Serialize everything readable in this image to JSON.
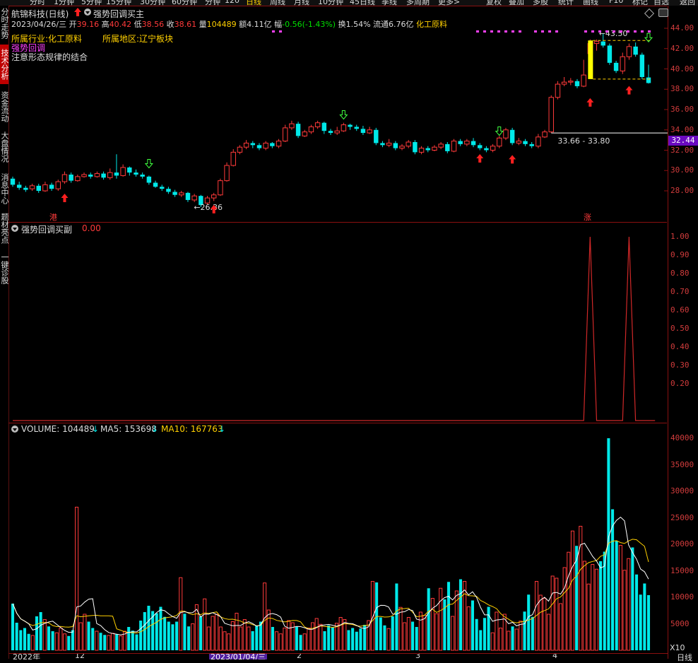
{
  "toolbar": {
    "items": [
      "分时",
      "1分钟",
      "5分钟",
      "15分钟",
      "30分钟",
      "60分钟",
      "分钟",
      "120",
      "日线",
      "周线",
      "月线",
      "10分钟",
      "45日线",
      "季线",
      "多周期",
      "更多>",
      "复权",
      "叠加",
      "多股",
      "统计",
      "画线",
      "F10",
      "标记",
      "自选",
      "返回"
    ],
    "active": "日线"
  },
  "sidebar": {
    "tabs": [
      "分时走势",
      "技术分析",
      "资金流动",
      "大盘情况",
      "消息中心",
      "题材亮点",
      "一键诊股"
    ],
    "active": "技术分析"
  },
  "header": {
    "stock": "航锦科技(日线)",
    "indicator": "强势回调买主",
    "date": "2023/04/26/三",
    "open_label": "开",
    "open": "39.16",
    "high_label": "高",
    "high": "40.42",
    "low_label": "低",
    "low": "38.56",
    "close_label": "收",
    "close": "38.61",
    "vol_label": "量",
    "vol": "104489",
    "amount_label": "额",
    "amount": "4.11亿",
    "change_label": "幅",
    "change": "-0.56(-1.43%)",
    "turnover_label": "换",
    "turnover": "1.54%",
    "float_label": "流通",
    "float": "6.76亿",
    "sector": "化工原料"
  },
  "info": {
    "industry": "所属行业:化工原料",
    "region": "所属地区:辽宁板块",
    "signal": "强势回调",
    "note": "注意形态规律的结合"
  },
  "price_annotations": {
    "high_mark": "43.50",
    "low_mark": "26.36",
    "range": "33.66 - 33.80",
    "current_price": "32.44",
    "label_gang": "港",
    "label_zhang": "涨"
  },
  "price_axis": [
    "44.00",
    "42.00",
    "40.00",
    "38.00",
    "36.00",
    "34.00",
    "32.00",
    "30.00",
    "28.00"
  ],
  "sub_panel": {
    "title": "强势回调买副",
    "value": "0.00",
    "axis": [
      "1.00",
      "0.90",
      "0.80",
      "0.70",
      "0.60",
      "0.50",
      "0.40",
      "0.30",
      "0.20"
    ]
  },
  "volume_panel": {
    "vol_label": "VOLUME: 104489",
    "ma5_label": "MA5: 153698",
    "ma10_label": "MA10: 167763",
    "axis": [
      "40000",
      "35000",
      "30000",
      "25000",
      "20000",
      "15000",
      "10000",
      "5000"
    ],
    "unit": "X10"
  },
  "bottom_axis": {
    "labels": [
      "2022年",
      "12",
      "2023/01/04/三",
      "2",
      "3",
      "4"
    ],
    "period": "日线"
  },
  "colors": {
    "up": "#ff3a3a",
    "down": "#00e8e8",
    "ma5": "#ffffff",
    "ma10": "#ffd000",
    "grid": "#8a1010",
    "signal": "#ff40ff"
  },
  "chart_data": {
    "type": "candlestick",
    "title": "航锦科技(日线)",
    "ylim": [
      25.5,
      44.5
    ],
    "candles": [
      [
        29.2,
        28.6,
        29.4,
        28.4
      ],
      [
        28.6,
        28.3,
        28.9,
        28.1
      ],
      [
        28.3,
        28.1,
        28.5,
        27.9
      ],
      [
        28.2,
        28.5,
        28.7,
        28.0
      ],
      [
        28.5,
        28.0,
        28.7,
        27.8
      ],
      [
        28.0,
        28.6,
        28.9,
        27.9
      ],
      [
        28.6,
        28.2,
        28.8,
        28.0
      ],
      [
        28.2,
        28.9,
        29.1,
        28.0
      ],
      [
        28.9,
        29.6,
        29.9,
        28.7
      ],
      [
        29.6,
        29.0,
        29.8,
        28.8
      ],
      [
        29.0,
        29.4,
        29.6,
        28.9
      ],
      [
        29.4,
        29.6,
        29.8,
        29.3
      ],
      [
        29.6,
        29.4,
        29.8,
        29.2
      ],
      [
        29.4,
        29.7,
        29.9,
        29.3
      ],
      [
        29.7,
        29.3,
        29.9,
        29.1
      ],
      [
        29.3,
        29.8,
        30.2,
        29.1
      ],
      [
        29.8,
        29.5,
        31.6,
        29.2
      ],
      [
        29.5,
        30.3,
        30.6,
        29.4
      ],
      [
        30.3,
        29.8,
        30.4,
        29.5
      ],
      [
        29.8,
        29.6,
        30.1,
        29.4
      ],
      [
        29.6,
        29.4,
        29.8,
        29.2
      ],
      [
        29.4,
        28.8,
        29.5,
        28.6
      ],
      [
        28.8,
        28.4,
        29.0,
        28.3
      ],
      [
        28.4,
        28.2,
        28.6,
        28.0
      ],
      [
        28.2,
        27.9,
        28.4,
        27.7
      ],
      [
        27.9,
        27.6,
        28.1,
        27.4
      ],
      [
        27.6,
        27.8,
        28.0,
        27.4
      ],
      [
        27.8,
        27.1,
        27.9,
        26.9
      ],
      [
        27.1,
        27.5,
        27.7,
        26.9
      ],
      [
        27.5,
        26.6,
        27.6,
        26.4
      ],
      [
        26.8,
        27.3,
        27.5,
        26.6
      ],
      [
        27.3,
        27.6,
        27.8,
        27.0
      ],
      [
        27.6,
        29.0,
        29.2,
        27.5
      ],
      [
        29.0,
        30.5,
        30.8,
        28.9
      ],
      [
        30.5,
        31.8,
        32.1,
        30.4
      ],
      [
        31.8,
        32.3,
        32.5,
        31.6
      ],
      [
        32.3,
        32.7,
        33.0,
        32.1
      ],
      [
        32.7,
        32.5,
        32.9,
        32.2
      ],
      [
        32.5,
        32.2,
        32.7,
        32.0
      ],
      [
        32.2,
        32.7,
        32.9,
        32.0
      ],
      [
        32.7,
        32.4,
        32.8,
        32.2
      ],
      [
        32.4,
        32.9,
        33.1,
        32.2
      ],
      [
        32.9,
        34.2,
        34.5,
        32.8
      ],
      [
        34.2,
        34.6,
        34.9,
        34.0
      ],
      [
        34.6,
        33.4,
        34.8,
        33.2
      ],
      [
        33.4,
        33.8,
        34.0,
        33.3
      ],
      [
        33.8,
        34.3,
        34.5,
        33.6
      ],
      [
        34.3,
        34.7,
        34.9,
        34.1
      ],
      [
        34.7,
        33.9,
        34.8,
        33.6
      ],
      [
        33.9,
        33.7,
        34.1,
        33.5
      ],
      [
        33.7,
        33.9,
        34.3,
        33.5
      ],
      [
        33.9,
        34.5,
        34.7,
        33.8
      ],
      [
        34.5,
        34.3,
        34.6,
        34.0
      ],
      [
        34.3,
        34.1,
        34.5,
        33.9
      ],
      [
        34.1,
        33.7,
        34.4,
        33.5
      ],
      [
        33.7,
        34.0,
        34.3,
        33.6
      ],
      [
        34.0,
        32.7,
        34.2,
        32.5
      ],
      [
        32.7,
        32.5,
        32.9,
        32.3
      ],
      [
        32.5,
        32.7,
        33.1,
        32.3
      ],
      [
        32.7,
        32.2,
        32.9,
        32.0
      ],
      [
        32.2,
        32.4,
        32.6,
        32.0
      ],
      [
        32.4,
        32.8,
        33.0,
        32.2
      ],
      [
        32.8,
        31.8,
        33.0,
        31.6
      ],
      [
        31.8,
        32.2,
        32.4,
        31.6
      ],
      [
        32.2,
        32.0,
        32.4,
        31.8
      ],
      [
        32.0,
        32.3,
        32.5,
        31.9
      ],
      [
        32.3,
        32.6,
        32.8,
        32.1
      ],
      [
        32.6,
        31.9,
        32.8,
        31.7
      ],
      [
        31.9,
        32.9,
        33.1,
        31.8
      ],
      [
        32.9,
        32.6,
        33.1,
        32.4
      ],
      [
        32.6,
        32.9,
        33.1,
        32.4
      ],
      [
        32.9,
        32.5,
        33.2,
        32.3
      ],
      [
        32.5,
        32.2,
        32.7,
        32.0
      ],
      [
        32.2,
        32.0,
        32.4,
        31.8
      ],
      [
        32.0,
        32.4,
        32.6,
        31.8
      ],
      [
        32.4,
        33.2,
        33.4,
        32.2
      ],
      [
        33.2,
        34.0,
        34.2,
        33.0
      ],
      [
        34.0,
        32.7,
        34.2,
        32.5
      ],
      [
        32.7,
        32.9,
        33.2,
        32.5
      ],
      [
        32.9,
        32.6,
        33.1,
        32.4
      ],
      [
        32.6,
        32.4,
        32.8,
        32.2
      ],
      [
        32.4,
        33.3,
        33.6,
        32.2
      ],
      [
        33.3,
        33.8,
        34.0,
        33.2
      ],
      [
        33.8,
        37.2,
        37.4,
        33.7
      ],
      [
        37.2,
        38.5,
        38.8,
        37.0
      ],
      [
        38.5,
        38.7,
        39.2,
        38.3
      ],
      [
        38.7,
        38.8,
        39.1,
        38.4
      ],
      [
        38.8,
        38.3,
        39.0,
        38.1
      ],
      [
        38.3,
        39.4,
        40.9,
        38.2
      ],
      [
        41.5,
        42.5,
        42.9,
        41.3
      ],
      [
        42.5,
        42.7,
        42.9,
        41.8
      ],
      [
        42.7,
        42.3,
        43.5,
        42.1
      ],
      [
        42.3,
        40.6,
        42.5,
        40.4
      ],
      [
        40.6,
        39.8,
        40.8,
        39.6
      ],
      [
        39.8,
        41.2,
        41.6,
        39.5
      ],
      [
        41.2,
        42.2,
        42.5,
        40.9
      ],
      [
        42.2,
        41.4,
        42.6,
        41.2
      ],
      [
        41.4,
        39.2,
        41.6,
        39.0
      ],
      [
        39.16,
        38.61,
        40.42,
        38.56
      ]
    ],
    "signal_values": [
      0,
      0,
      0,
      0,
      0,
      0,
      0,
      0,
      0,
      0,
      0,
      0,
      0,
      0,
      0,
      0,
      0,
      0,
      0,
      0,
      0,
      0,
      0,
      0,
      0,
      0,
      0,
      0,
      0,
      0,
      0,
      0,
      0,
      0,
      0,
      0,
      0,
      0,
      0,
      0,
      0,
      0,
      0,
      0,
      0,
      0,
      0,
      0,
      0,
      0,
      0,
      0,
      0,
      0,
      0,
      0,
      0,
      0,
      0,
      0,
      0,
      0,
      0,
      0,
      0,
      0,
      0,
      0,
      0,
      0,
      0,
      0,
      0,
      0,
      0,
      0,
      0,
      0,
      0,
      0,
      0,
      0,
      0,
      0,
      0,
      0,
      0,
      0,
      0,
      1,
      0,
      0,
      0,
      0,
      0,
      1,
      0,
      0,
      0,
      0
    ],
    "volume": [
      8800,
      5200,
      3800,
      4200,
      3100,
      2800,
      6400,
      7200,
      5800,
      4500,
      3600,
      3300,
      4200,
      3100,
      2700,
      3800,
      27000,
      5200,
      6800,
      5400,
      4200,
      3600,
      3300,
      2900,
      2800,
      3200,
      3000,
      2700,
      3600,
      4400,
      3700,
      3000,
      5600,
      7200,
      8400,
      7400,
      7000,
      8200,
      6300,
      5400,
      4900,
      5400,
      13700,
      6900,
      4500,
      5000,
      8600,
      6400,
      9700,
      4400,
      6400,
      6800,
      4400,
      3500,
      3100,
      5400,
      7000,
      4400,
      5800,
      4400,
      3600,
      4600,
      5400,
      12700,
      7600,
      4400,
      3500,
      3100,
      4200,
      5600,
      5200,
      4400,
      2900,
      3100,
      4200,
      5200,
      6000,
      4900,
      3600,
      4700,
      4400,
      5100,
      6200,
      5800,
      3800,
      4200,
      3500,
      4100,
      4800,
      5600,
      13000,
      12800,
      6200,
      4700,
      4100,
      6400,
      12600,
      8100,
      5200,
      6200,
      5400,
      4400,
      7200,
      6600,
      11700,
      9800,
      6900,
      11700,
      9600,
      12900,
      6400,
      11200,
      13400,
      13000,
      8200,
      9400,
      5900,
      3800,
      6100,
      8200,
      3300,
      7200,
      4200,
      6800,
      3600,
      4500,
      4000,
      5500,
      7300,
      10500,
      6300,
      13000,
      10400,
      9800,
      6800,
      14000,
      13600,
      8800,
      15600,
      18500,
      22500,
      19700,
      23400,
      16800,
      12500,
      16200,
      15300,
      16800,
      18600,
      40000,
      26600,
      20600,
      19800,
      15100,
      17300,
      19400,
      14300,
      10500,
      12600,
      10400
    ]
  }
}
